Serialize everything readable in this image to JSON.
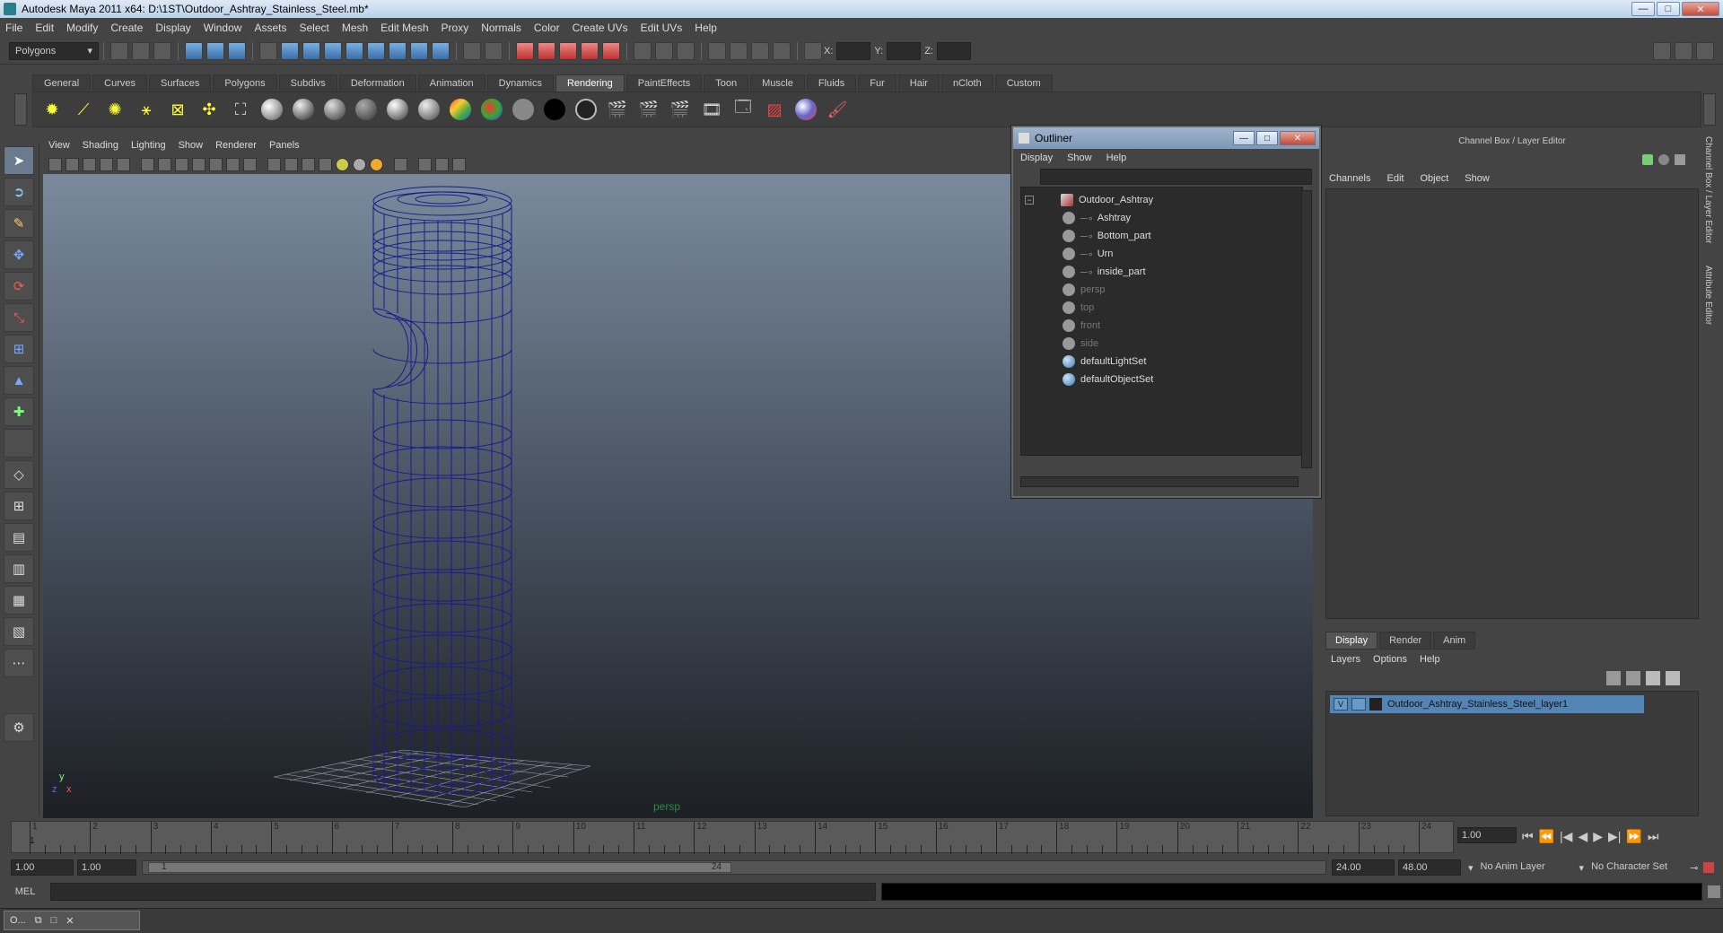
{
  "window": {
    "title": "Autodesk Maya 2011 x64: D:\\1ST\\Outdoor_Ashtray_Stainless_Steel.mb*",
    "minimize": "—",
    "maximize": "□",
    "close": "✕"
  },
  "menubar": [
    "File",
    "Edit",
    "Modify",
    "Create",
    "Display",
    "Window",
    "Assets",
    "Select",
    "Mesh",
    "Edit Mesh",
    "Proxy",
    "Normals",
    "Color",
    "Create UVs",
    "Edit UVs",
    "Help"
  ],
  "statusline": {
    "mode": "Polygons",
    "x_label": "X:",
    "y_label": "Y:",
    "z_label": "Z:"
  },
  "shelf_tabs": [
    "General",
    "Curves",
    "Surfaces",
    "Polygons",
    "Subdivs",
    "Deformation",
    "Animation",
    "Dynamics",
    "Rendering",
    "PaintEffects",
    "Toon",
    "Muscle",
    "Fluids",
    "Fur",
    "Hair",
    "nCloth",
    "Custom"
  ],
  "shelf_active_tab": "Rendering",
  "viewport": {
    "menu": [
      "View",
      "Shading",
      "Lighting",
      "Show",
      "Renderer",
      "Panels"
    ],
    "camera_label": "persp",
    "axis_y": "y",
    "axis_x": "x",
    "axis_z": "z"
  },
  "outliner": {
    "title": "Outliner",
    "menu": [
      "Display",
      "Show",
      "Help"
    ],
    "expander": "−",
    "root": "Outdoor_Ashtray",
    "children": [
      "Ashtray",
      "Bottom_part",
      "Urn",
      "inside_part"
    ],
    "cameras": [
      "persp",
      "top",
      "front",
      "side"
    ],
    "sets": [
      "defaultLightSet",
      "defaultObjectSet"
    ]
  },
  "channelbox": {
    "header": "Channel Box / Layer Editor",
    "menu": [
      "Channels",
      "Edit",
      "Object",
      "Show"
    ]
  },
  "side_tabs": [
    "Channel Box / Layer Editor",
    "Attribute Editor"
  ],
  "layer_editor": {
    "tabs": [
      "Display",
      "Render",
      "Anim"
    ],
    "active_tab": "Display",
    "menu": [
      "Layers",
      "Options",
      "Help"
    ],
    "layer_visible": "V",
    "layer_name": "Outdoor_Ashtray_Stainless_Steel_layer1"
  },
  "timeslider": {
    "frames": [
      "1",
      "2",
      "3",
      "4",
      "5",
      "6",
      "7",
      "8",
      "9",
      "10",
      "11",
      "12",
      "13",
      "14",
      "15",
      "16",
      "17",
      "18",
      "19",
      "20",
      "21",
      "22",
      "23",
      "24"
    ],
    "current_marker": "1",
    "current_frame": "1.00"
  },
  "playback_icons": [
    "⏮",
    "⏪",
    "|◀",
    "◀",
    "▶",
    "▶|",
    "⏩",
    "⏭"
  ],
  "range": {
    "start_time": "1.00",
    "playback_start": "1.00",
    "range_start_label": "1",
    "range_end_label": "24",
    "playback_end": "24.00",
    "end_time": "48.00",
    "anim_layer": "No Anim Layer",
    "character_set": "No Character Set"
  },
  "cmdline": {
    "mel_label": "MEL"
  },
  "taskbar": {
    "item_label": "O..."
  }
}
